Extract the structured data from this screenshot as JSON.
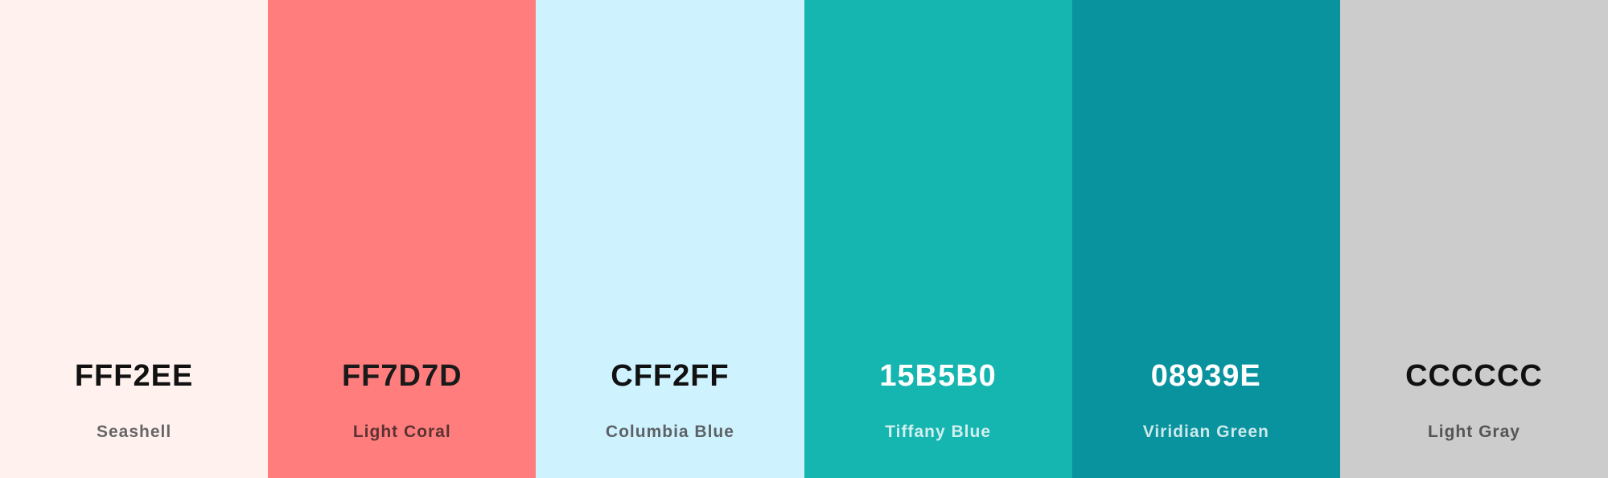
{
  "palette": {
    "swatches": [
      {
        "hex": "FFF2EE",
        "name": "Seashell",
        "color": "#FFF2EE",
        "hex_color": "#111111",
        "name_color": "#666666"
      },
      {
        "hex": "FF7D7D",
        "name": "Light Coral",
        "color": "#FF7D7D",
        "hex_color": "#1a1a1a",
        "name_color": "#5a3232"
      },
      {
        "hex": "CFF2FF",
        "name": "Columbia Blue",
        "color": "#CFF2FF",
        "hex_color": "#111111",
        "name_color": "#5c6266"
      },
      {
        "hex": "15B5B0",
        "name": "Tiffany Blue",
        "color": "#15B5B0",
        "hex_color": "#ffffff",
        "name_color": "#d2f0ef"
      },
      {
        "hex": "08939E",
        "name": "Viridian Green",
        "color": "#08939E",
        "hex_color": "#ffffff",
        "name_color": "#cde9ec"
      },
      {
        "hex": "CCCCCC",
        "name": "Light Gray",
        "color": "#CCCCCC",
        "hex_color": "#111111",
        "name_color": "#555555"
      }
    ]
  }
}
